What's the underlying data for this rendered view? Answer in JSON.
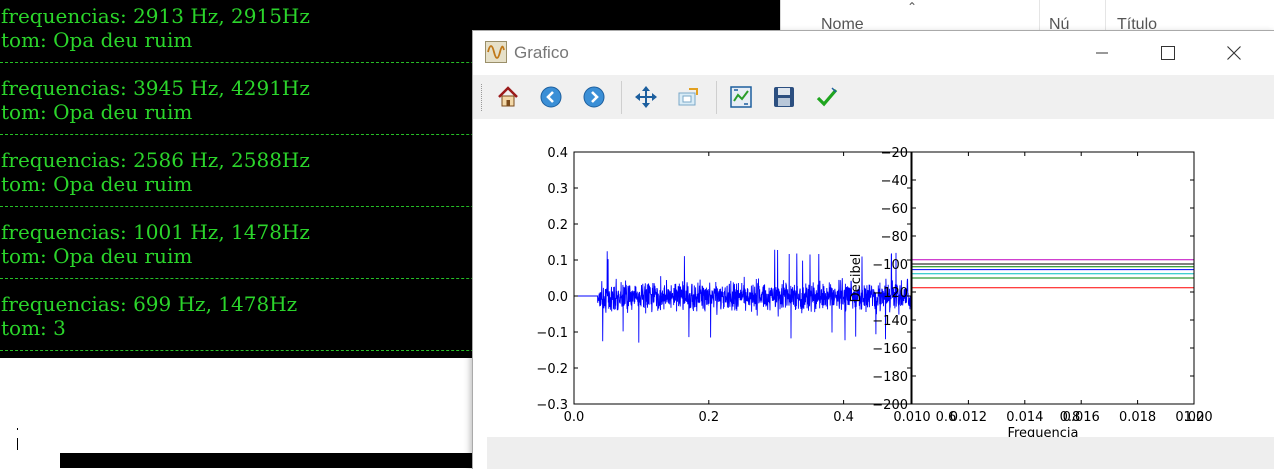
{
  "terminal": {
    "entries": [
      {
        "freq": "frequencias: 2913 Hz, 2915Hz",
        "tom": "tom: Opa deu ruim"
      },
      {
        "freq": "frequencias: 3945 Hz, 4291Hz",
        "tom": "tom: Opa deu ruim"
      },
      {
        "freq": "frequencias: 2586 Hz, 2588Hz",
        "tom": "tom: Opa deu ruim"
      },
      {
        "freq": "frequencias: 1001 Hz, 1478Hz",
        "tom": "tom: Opa deu ruim"
      },
      {
        "freq": "frequencias: 699 Hz, 1478Hz",
        "tom": "tom: 3"
      }
    ],
    "text_color": "#2bd52b"
  },
  "explorer": {
    "columns": [
      "Nome",
      "Nú",
      "Título"
    ]
  },
  "window": {
    "title": "Grafico",
    "controls": {
      "minimize": "minimize-icon",
      "maximize": "maximize-icon",
      "close": "close-icon"
    }
  },
  "toolbar": {
    "buttons": [
      "home-icon",
      "back-icon",
      "forward-icon",
      "pan-icon",
      "zoom-icon",
      "configure-subplots-icon",
      "save-icon",
      "edit-check-icon"
    ]
  },
  "chart_data": [
    {
      "type": "line",
      "title": "",
      "xlabel": "",
      "ylabel": "",
      "xlim": [
        0.0,
        0.5
      ],
      "ylim": [
        -0.3,
        0.4
      ],
      "x_ticks": [
        "0.0",
        "0.2",
        "0.4"
      ],
      "y_ticks": [
        "0.4",
        "0.3",
        "0.2",
        "0.1",
        "0.0",
        "−0.1",
        "−0.2",
        "−0.3"
      ],
      "series": [
        {
          "color": "#0000ff",
          "signal_start": 0.035,
          "amplitude_typical": 0.06,
          "amplitude_peak": 0.13
        }
      ]
    },
    {
      "type": "line",
      "title": "",
      "xlabel": "Frequencia",
      "ylabel": "Decibel",
      "xlim": [
        0.01,
        0.02
      ],
      "ylim": [
        -200,
        -20
      ],
      "x_ticks": [
        "0.010",
        "0.012",
        "0.014",
        "0.016",
        "0.018",
        "0.020"
      ],
      "x_ticks_overlap": [
        "0.6",
        "0.8",
        "1.0"
      ],
      "y_ticks": [
        "−20",
        "−40",
        "−60",
        "−80",
        "−100",
        "−120",
        "−140",
        "−160",
        "−180",
        "−200"
      ],
      "series": [
        {
          "color": "#bf00bf",
          "values": [
            -97,
            -97
          ]
        },
        {
          "color": "#000000",
          "values": [
            -100,
            -100
          ]
        },
        {
          "color": "#008000",
          "values": [
            -102,
            -102
          ]
        },
        {
          "color": "#0000ff",
          "values": [
            -104,
            -104
          ]
        },
        {
          "color": "#00bfbf",
          "values": [
            -107,
            -107
          ]
        },
        {
          "color": "#008000",
          "values": [
            -110,
            -110
          ]
        },
        {
          "color": "#ff0000",
          "values": [
            -117,
            -117
          ]
        }
      ]
    }
  ]
}
